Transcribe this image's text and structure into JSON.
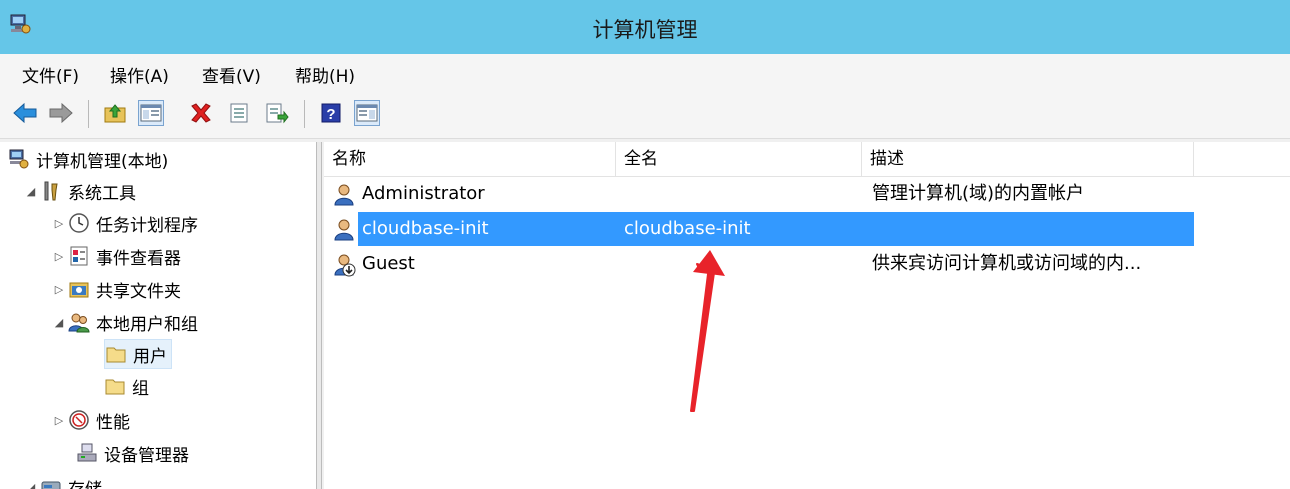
{
  "window": {
    "title": "计算机管理"
  },
  "menu": [
    "文件(F)",
    "操作(A)",
    "查看(V)",
    "帮助(H)"
  ],
  "tree": {
    "items": [
      {
        "label": "计算机管理(本地)",
        "icon": "computer-management-icon",
        "expander": ""
      },
      {
        "label": "系统工具",
        "icon": "system-tools-icon",
        "expander": "◢"
      },
      {
        "label": "任务计划程序",
        "icon": "clock-icon",
        "expander": "▷"
      },
      {
        "label": "事件查看器",
        "icon": "event-viewer-icon",
        "expander": "▷"
      },
      {
        "label": "共享文件夹",
        "icon": "shared-folder-icon",
        "expander": "▷"
      },
      {
        "label": "本地用户和组",
        "icon": "users-groups-icon",
        "expander": "◢"
      },
      {
        "label": "用户",
        "icon": "folder-icon",
        "expander": ""
      },
      {
        "label": "组",
        "icon": "folder-icon",
        "expander": ""
      },
      {
        "label": "性能",
        "icon": "performance-icon",
        "expander": "▷"
      },
      {
        "label": "设备管理器",
        "icon": "device-manager-icon",
        "expander": ""
      },
      {
        "label": "存储",
        "icon": "storage-icon",
        "expander": "◢"
      }
    ]
  },
  "list": {
    "columns": [
      "名称",
      "全名",
      "描述"
    ],
    "rows": [
      {
        "name": "Administrator",
        "fullname": "",
        "description": "管理计算机(域)的内置帐户"
      },
      {
        "name": "cloudbase-init",
        "fullname": "cloudbase-init",
        "description": ""
      },
      {
        "name": "Guest",
        "fullname": "",
        "description": "供来宾访问计算机或访问域的内..."
      }
    ]
  },
  "colors": {
    "titlebar": "#65c6e8",
    "selection": "#3399ff",
    "annotation_arrow": "#e8232a"
  }
}
